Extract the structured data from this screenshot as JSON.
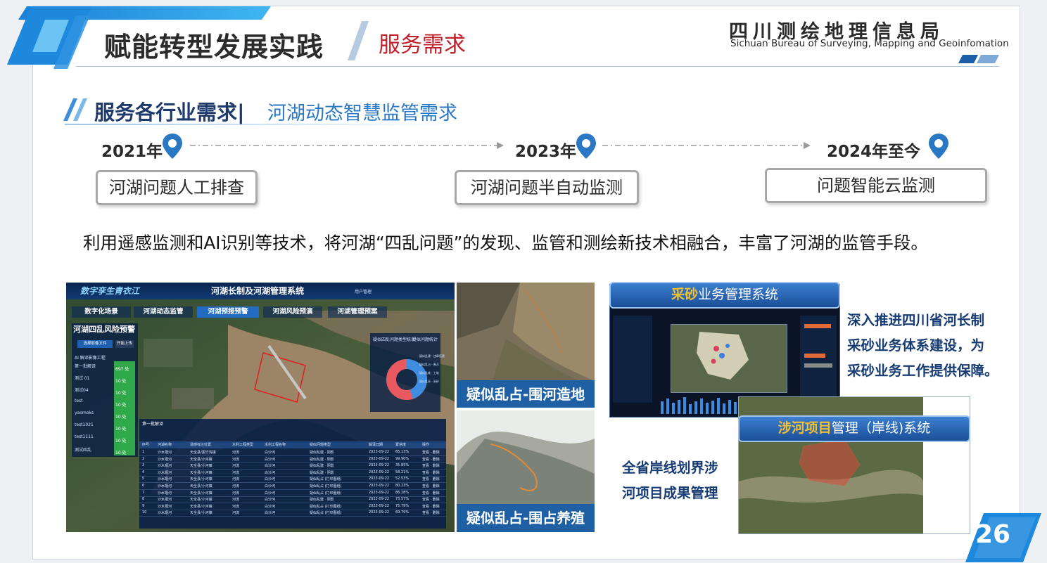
{
  "header": {
    "title": "赋能转型发展实践",
    "subtitle": "服务需求",
    "org_cn": "四川测绘地理信息局",
    "org_en": "Sichuan Bureau of Surveying, Mapping and Geoinfomation"
  },
  "section": {
    "main": "服务各行业需求",
    "separator": "|",
    "sub": "河湖动态智慧监管需求"
  },
  "timeline": [
    {
      "year": "2021年",
      "stage": "河湖问题人工排查"
    },
    {
      "year": "2023年",
      "stage": "河湖问题半自动监测"
    },
    {
      "year": "2024年至今",
      "stage": "问题智能云监测"
    }
  ],
  "description": "利用遥感监测和AI识别等技术，将河湖“四乱问题”的发现、监管和测绘新技术相融合，丰富了河湖的监管手段。",
  "dashboard": {
    "logo": "数字孪生青衣江",
    "system_title": "河湖长制及河湖管理系统",
    "user": "用户管理",
    "tabs": [
      "数字化场景",
      "河湖动态监管",
      "河湖预报预警",
      "河湖风险预演",
      "河湖管理预案"
    ],
    "panel_title": "河湖四乱风险预警",
    "upload_btn": "选择影像文件",
    "upload_btn2": "开始上传",
    "list_header": "AI 解译影像工程",
    "list_items": [
      "第一批解译",
      "测试 01",
      "测试04",
      "test",
      "yaomoks",
      "test1021",
      "test1111",
      "测试四乱"
    ],
    "list_counts": [
      "697 处",
      "10 处",
      "10 处",
      "10 处",
      "10 处",
      "10 处",
      "10 处",
      "10 处"
    ],
    "chart_title": "疑似四乱问题类型统计",
    "chart_title2": "疑似问题统计",
    "legend": [
      "疑似乱建 · 违章搭建",
      "疑似乱占 · 围占",
      "疑似乱堆 · 土堆",
      "疑似乱采 · 采砂"
    ],
    "table_title": "第一批解译",
    "table_headers": [
      "序号",
      "河湖名称",
      "遥感标注位置",
      "水利工程类型",
      "水利工程名称",
      "疑似问题类型",
      "解译日期",
      "置信度",
      "操作"
    ],
    "table_rows": [
      [
        "1",
        "沙水堰河",
        "天全县/黑竹沟镇",
        "河流",
        "白沙河",
        "疑似乱建 · 阴影",
        "2023-09-22",
        "65.13%",
        "查看 · 删除"
      ],
      [
        "2",
        "沙水堰河",
        "天全县/小河镇",
        "河流",
        "白沙河",
        "疑似乱建 · 阴影",
        "2023-09-22",
        "99.90%",
        "查看 · 删除"
      ],
      [
        "3",
        "沙水堰河",
        "天全县/小河镇",
        "河流",
        "白沙河",
        "疑似乱建 · 阴影",
        "2023-09-22",
        "35.85%",
        "查看 · 删除"
      ],
      [
        "4",
        "沙水堰河",
        "天全县/小河镇",
        "河流",
        "白沙河",
        "疑似乱建 · 阴影",
        "2023-09-22",
        "58.21%",
        "查看 · 删除"
      ],
      [
        "5",
        "沙水堰河",
        "天全县/小河镇",
        "河流",
        "白沙河",
        "疑似乱占 (打印图纸)",
        "2023-09-22",
        "52.53%",
        "查看 · 删除"
      ],
      [
        "6",
        "沙水堰河",
        "天全县/小河镇",
        "河流",
        "白沙河",
        "疑似乱占 (打印图纸)",
        "2023-09-22",
        "80.23%",
        "查看 · 删除"
      ],
      [
        "7",
        "沙水堰河",
        "天全县/小河镇",
        "河流",
        "白沙河",
        "疑似乱占 (打印图纸)",
        "2023-09-22",
        "86.28%",
        "查看 · 删除"
      ],
      [
        "8",
        "沙水堰河",
        "天全县/小河镇",
        "河流",
        "白沙河",
        "疑似乱建 · 阴影",
        "2023-09-22",
        "73.57%",
        "查看 · 删除"
      ],
      [
        "9",
        "沙水堰河",
        "天全县/小河镇",
        "河流",
        "白沙河",
        "疑似乱占 (打印图纸)",
        "2023-09-22",
        "75.79%",
        "查看 · 删除"
      ],
      [
        "10",
        "沙水堰河",
        "天全县/小河镇",
        "河流",
        "白沙河",
        "疑似乱占 (打印图纸)",
        "2023-09-22",
        "69.79%",
        "查看 · 删除"
      ]
    ]
  },
  "captions": {
    "top": "疑似乱占-围河造地",
    "bottom": "疑似乱占-围占养殖"
  },
  "sand_window": {
    "title_highlight": "采砂",
    "title_rest": "业务管理系统"
  },
  "sand_text": [
    "深入推进四川省河长制",
    "采砂业务体系建设，为",
    "采砂业务工作提供保障。"
  ],
  "river_window": {
    "title_highlight": "涉河项目",
    "title_rest": "管理（岸线)系统"
  },
  "river_text": [
    "全省岸线划界涉",
    "河项目成果管理"
  ],
  "page_number": "26",
  "colors": {
    "accent_blue": "#2a78c4",
    "title_red": "#c0202a",
    "caption_bg": "#1f5fa3",
    "highlight_yellow": "#f2c12e"
  }
}
